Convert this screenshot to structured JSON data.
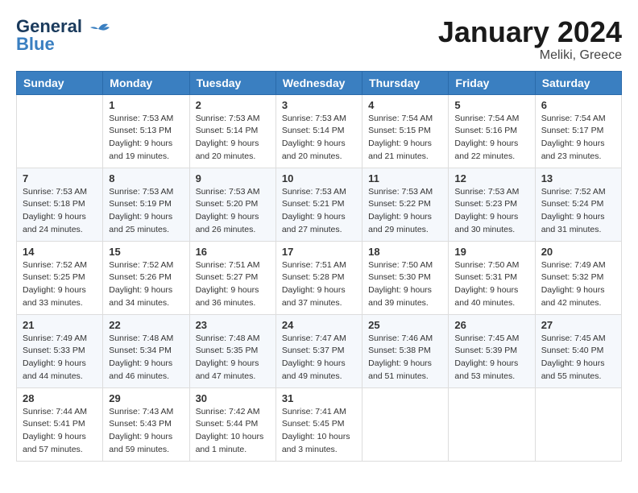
{
  "header": {
    "logo_line1": "General",
    "logo_line2": "Blue",
    "month_title": "January 2024",
    "location": "Meliki, Greece"
  },
  "weekdays": [
    "Sunday",
    "Monday",
    "Tuesday",
    "Wednesday",
    "Thursday",
    "Friday",
    "Saturday"
  ],
  "weeks": [
    [
      {
        "day": "",
        "sunrise": "",
        "sunset": "",
        "daylight": ""
      },
      {
        "day": "1",
        "sunrise": "Sunrise: 7:53 AM",
        "sunset": "Sunset: 5:13 PM",
        "daylight": "Daylight: 9 hours and 19 minutes."
      },
      {
        "day": "2",
        "sunrise": "Sunrise: 7:53 AM",
        "sunset": "Sunset: 5:14 PM",
        "daylight": "Daylight: 9 hours and 20 minutes."
      },
      {
        "day": "3",
        "sunrise": "Sunrise: 7:53 AM",
        "sunset": "Sunset: 5:14 PM",
        "daylight": "Daylight: 9 hours and 20 minutes."
      },
      {
        "day": "4",
        "sunrise": "Sunrise: 7:54 AM",
        "sunset": "Sunset: 5:15 PM",
        "daylight": "Daylight: 9 hours and 21 minutes."
      },
      {
        "day": "5",
        "sunrise": "Sunrise: 7:54 AM",
        "sunset": "Sunset: 5:16 PM",
        "daylight": "Daylight: 9 hours and 22 minutes."
      },
      {
        "day": "6",
        "sunrise": "Sunrise: 7:54 AM",
        "sunset": "Sunset: 5:17 PM",
        "daylight": "Daylight: 9 hours and 23 minutes."
      }
    ],
    [
      {
        "day": "7",
        "sunrise": "Sunrise: 7:53 AM",
        "sunset": "Sunset: 5:18 PM",
        "daylight": "Daylight: 9 hours and 24 minutes."
      },
      {
        "day": "8",
        "sunrise": "Sunrise: 7:53 AM",
        "sunset": "Sunset: 5:19 PM",
        "daylight": "Daylight: 9 hours and 25 minutes."
      },
      {
        "day": "9",
        "sunrise": "Sunrise: 7:53 AM",
        "sunset": "Sunset: 5:20 PM",
        "daylight": "Daylight: 9 hours and 26 minutes."
      },
      {
        "day": "10",
        "sunrise": "Sunrise: 7:53 AM",
        "sunset": "Sunset: 5:21 PM",
        "daylight": "Daylight: 9 hours and 27 minutes."
      },
      {
        "day": "11",
        "sunrise": "Sunrise: 7:53 AM",
        "sunset": "Sunset: 5:22 PM",
        "daylight": "Daylight: 9 hours and 29 minutes."
      },
      {
        "day": "12",
        "sunrise": "Sunrise: 7:53 AM",
        "sunset": "Sunset: 5:23 PM",
        "daylight": "Daylight: 9 hours and 30 minutes."
      },
      {
        "day": "13",
        "sunrise": "Sunrise: 7:52 AM",
        "sunset": "Sunset: 5:24 PM",
        "daylight": "Daylight: 9 hours and 31 minutes."
      }
    ],
    [
      {
        "day": "14",
        "sunrise": "Sunrise: 7:52 AM",
        "sunset": "Sunset: 5:25 PM",
        "daylight": "Daylight: 9 hours and 33 minutes."
      },
      {
        "day": "15",
        "sunrise": "Sunrise: 7:52 AM",
        "sunset": "Sunset: 5:26 PM",
        "daylight": "Daylight: 9 hours and 34 minutes."
      },
      {
        "day": "16",
        "sunrise": "Sunrise: 7:51 AM",
        "sunset": "Sunset: 5:27 PM",
        "daylight": "Daylight: 9 hours and 36 minutes."
      },
      {
        "day": "17",
        "sunrise": "Sunrise: 7:51 AM",
        "sunset": "Sunset: 5:28 PM",
        "daylight": "Daylight: 9 hours and 37 minutes."
      },
      {
        "day": "18",
        "sunrise": "Sunrise: 7:50 AM",
        "sunset": "Sunset: 5:30 PM",
        "daylight": "Daylight: 9 hours and 39 minutes."
      },
      {
        "day": "19",
        "sunrise": "Sunrise: 7:50 AM",
        "sunset": "Sunset: 5:31 PM",
        "daylight": "Daylight: 9 hours and 40 minutes."
      },
      {
        "day": "20",
        "sunrise": "Sunrise: 7:49 AM",
        "sunset": "Sunset: 5:32 PM",
        "daylight": "Daylight: 9 hours and 42 minutes."
      }
    ],
    [
      {
        "day": "21",
        "sunrise": "Sunrise: 7:49 AM",
        "sunset": "Sunset: 5:33 PM",
        "daylight": "Daylight: 9 hours and 44 minutes."
      },
      {
        "day": "22",
        "sunrise": "Sunrise: 7:48 AM",
        "sunset": "Sunset: 5:34 PM",
        "daylight": "Daylight: 9 hours and 46 minutes."
      },
      {
        "day": "23",
        "sunrise": "Sunrise: 7:48 AM",
        "sunset": "Sunset: 5:35 PM",
        "daylight": "Daylight: 9 hours and 47 minutes."
      },
      {
        "day": "24",
        "sunrise": "Sunrise: 7:47 AM",
        "sunset": "Sunset: 5:37 PM",
        "daylight": "Daylight: 9 hours and 49 minutes."
      },
      {
        "day": "25",
        "sunrise": "Sunrise: 7:46 AM",
        "sunset": "Sunset: 5:38 PM",
        "daylight": "Daylight: 9 hours and 51 minutes."
      },
      {
        "day": "26",
        "sunrise": "Sunrise: 7:45 AM",
        "sunset": "Sunset: 5:39 PM",
        "daylight": "Daylight: 9 hours and 53 minutes."
      },
      {
        "day": "27",
        "sunrise": "Sunrise: 7:45 AM",
        "sunset": "Sunset: 5:40 PM",
        "daylight": "Daylight: 9 hours and 55 minutes."
      }
    ],
    [
      {
        "day": "28",
        "sunrise": "Sunrise: 7:44 AM",
        "sunset": "Sunset: 5:41 PM",
        "daylight": "Daylight: 9 hours and 57 minutes."
      },
      {
        "day": "29",
        "sunrise": "Sunrise: 7:43 AM",
        "sunset": "Sunset: 5:43 PM",
        "daylight": "Daylight: 9 hours and 59 minutes."
      },
      {
        "day": "30",
        "sunrise": "Sunrise: 7:42 AM",
        "sunset": "Sunset: 5:44 PM",
        "daylight": "Daylight: 10 hours and 1 minute."
      },
      {
        "day": "31",
        "sunrise": "Sunrise: 7:41 AM",
        "sunset": "Sunset: 5:45 PM",
        "daylight": "Daylight: 10 hours and 3 minutes."
      },
      {
        "day": "",
        "sunrise": "",
        "sunset": "",
        "daylight": ""
      },
      {
        "day": "",
        "sunrise": "",
        "sunset": "",
        "daylight": ""
      },
      {
        "day": "",
        "sunrise": "",
        "sunset": "",
        "daylight": ""
      }
    ]
  ]
}
